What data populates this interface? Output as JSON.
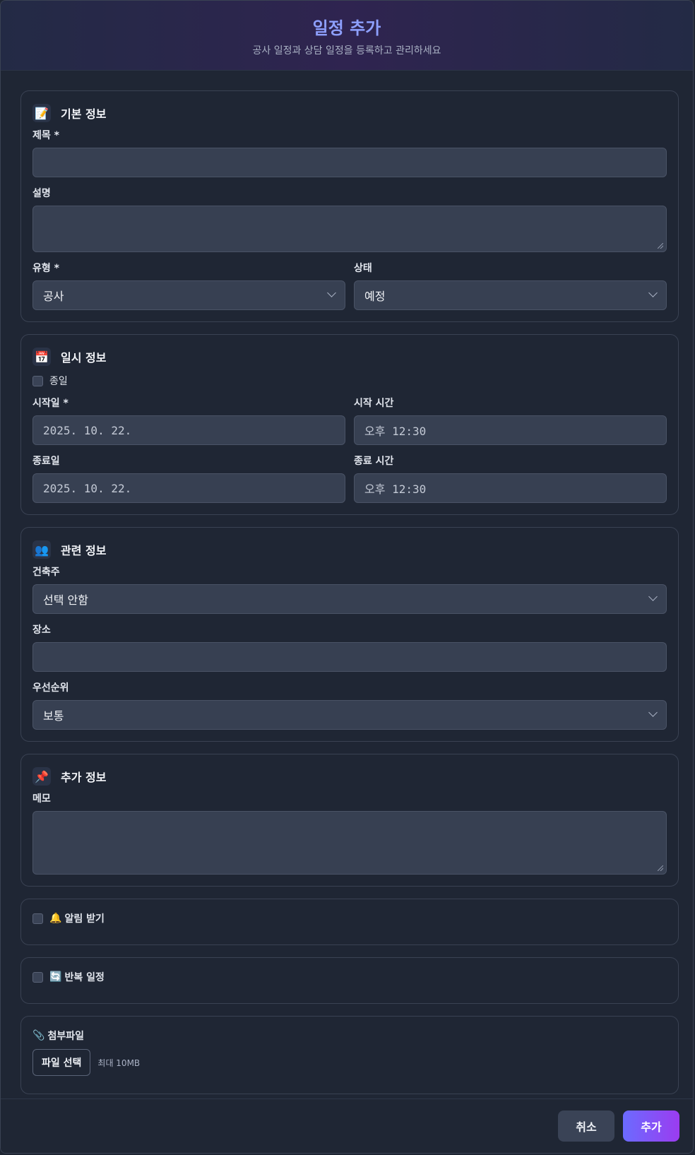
{
  "header": {
    "title": "일정 추가",
    "subtitle": "공사 일정과 상담 일정을 등록하고 관리하세요"
  },
  "basic": {
    "icon": "memo-icon",
    "title": "기본 정보",
    "title_label": "제목 *",
    "title_value": "",
    "desc_label": "설명",
    "desc_value": "",
    "type_label": "유형 *",
    "type_value": "공사",
    "status_label": "상태",
    "status_value": "예정"
  },
  "datetime": {
    "icon": "calendar-icon",
    "title": "일시 정보",
    "allday_label": "종일",
    "start_date_label": "시작일 *",
    "start_date_value": "2025. 10. 22.",
    "start_time_label": "시작 시간",
    "start_time_value": "오후 12:30",
    "end_date_label": "종료일",
    "end_date_value": "2025. 10. 22.",
    "end_time_label": "종료 시간",
    "end_time_value": "오후 12:30"
  },
  "related": {
    "icon": "people-icon",
    "title": "관련 정보",
    "client_label": "건축주",
    "client_value": "선택 안함",
    "place_label": "장소",
    "place_value": "",
    "priority_label": "우선순위",
    "priority_value": "보통"
  },
  "extra": {
    "icon": "pushpin-icon",
    "title": "추가 정보",
    "memo_label": "메모",
    "memo_value": ""
  },
  "notify": {
    "icon": "bell-icon",
    "label": "알림 받기"
  },
  "repeat": {
    "icon": "repeat-icon",
    "label": "반복 일정"
  },
  "attachment": {
    "icon": "paperclip-icon",
    "label": "첨부파일",
    "button": "파일 선택",
    "hint": "최대 10MB"
  },
  "footer": {
    "cancel": "취소",
    "submit": "추가"
  },
  "colors": {
    "accent": "#8ea0ff",
    "submit_gradient_start": "#6b6bff",
    "submit_gradient_end": "#9b3cf0",
    "background": "#1f2634"
  }
}
